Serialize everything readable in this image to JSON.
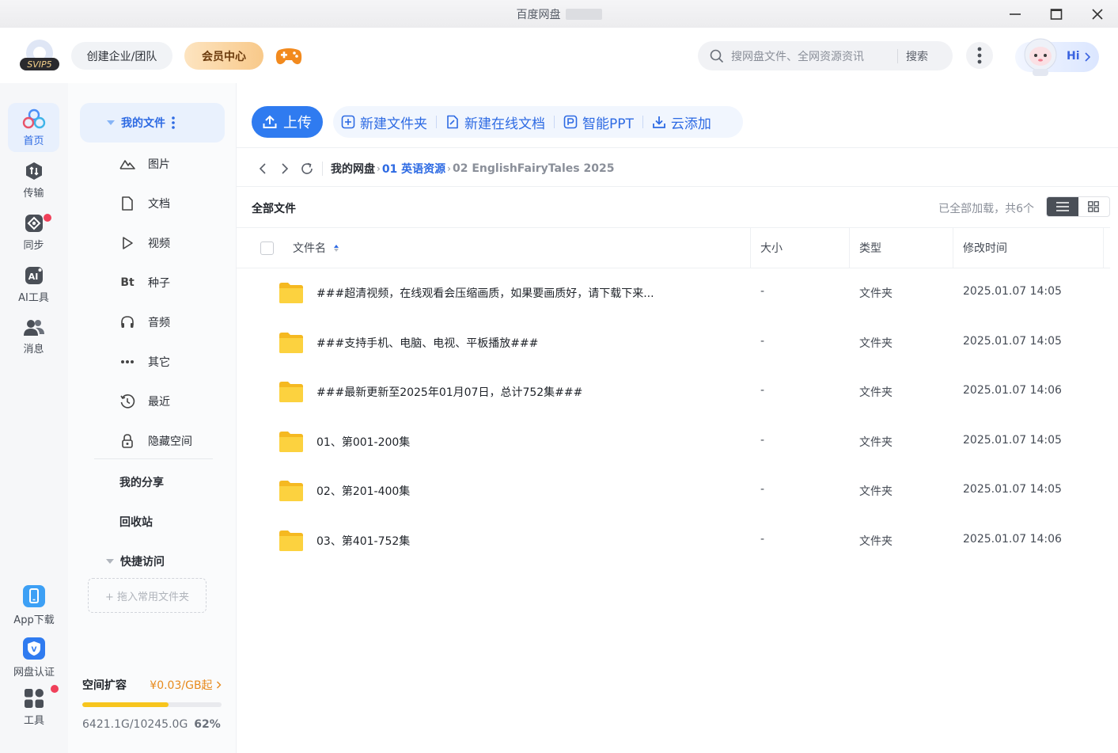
{
  "window": {
    "title": "百度网盘"
  },
  "header": {
    "logo_text": "SVIP5",
    "enterprise_label": "创建企业/团队",
    "vip_label": "会员中心",
    "search_placeholder": "搜网盘文件、全网资源资讯",
    "search_button": "搜索",
    "hi_label": "Hi"
  },
  "rail": {
    "items": [
      {
        "label": "首页",
        "icon": "home-icon"
      },
      {
        "label": "传输",
        "icon": "transfer-icon"
      },
      {
        "label": "同步",
        "icon": "sync-icon"
      },
      {
        "label": "AI工具",
        "icon": "ai-tool-icon"
      },
      {
        "label": "消息",
        "icon": "message-icon"
      }
    ],
    "bottom": [
      {
        "label": "App下载",
        "icon": "phone-icon"
      },
      {
        "label": "网盘认证",
        "icon": "verify-icon"
      },
      {
        "label": "工具",
        "icon": "tools-icon"
      }
    ]
  },
  "sidebar": {
    "my_files": "我的文件",
    "categories": [
      {
        "label": "图片",
        "icon": "picture-icon"
      },
      {
        "label": "文档",
        "icon": "document-icon"
      },
      {
        "label": "视频",
        "icon": "video-icon"
      },
      {
        "label": "种子",
        "icon": "torrent-icon",
        "glyph": "Bt"
      },
      {
        "label": "音频",
        "icon": "headphones-icon"
      },
      {
        "label": "其它",
        "icon": "more-dots-icon"
      },
      {
        "label": "最近",
        "icon": "history-icon"
      },
      {
        "label": "隐藏空间",
        "icon": "lock-icon"
      }
    ],
    "my_share": "我的分享",
    "recycle": "回收站",
    "quick_access": "快捷访问",
    "drop_hint": "+ 拖入常用文件夹",
    "storage": {
      "label": "空间扩容",
      "price": "¥0.03/GB起",
      "used": "6421.1G/10245.0G",
      "percent_text": "62%",
      "percent": 62
    }
  },
  "toolbar": {
    "upload": "上传",
    "new_folder": "新建文件夹",
    "new_doc": "新建在线文档",
    "smart_ppt": "智能PPT",
    "cloud_add": "云添加"
  },
  "breadcrumb": {
    "root": "我的网盘",
    "level1": "01 英语资源",
    "current": "02 EnglishFairyTales 2025"
  },
  "list": {
    "title": "全部文件",
    "status": "已全部加载，共6个",
    "columns": {
      "name": "文件名",
      "size": "大小",
      "type": "类型",
      "time": "修改时间"
    },
    "rows": [
      {
        "name": "###超清视频，在线观看会压缩画质，如果要画质好，请下载下来...",
        "size": "-",
        "type": "文件夹",
        "time": "2025.01.07 14:05"
      },
      {
        "name": "###支持手机、电脑、电视、平板播放###",
        "size": "-",
        "type": "文件夹",
        "time": "2025.01.07 14:05"
      },
      {
        "name": "###最新更新至2025年01月07日，总计752集###",
        "size": "-",
        "type": "文件夹",
        "time": "2025.01.07 14:06"
      },
      {
        "name": "01、第001-200集",
        "size": "-",
        "type": "文件夹",
        "time": "2025.01.07 14:05"
      },
      {
        "name": "02、第201-400集",
        "size": "-",
        "type": "文件夹",
        "time": "2025.01.07 14:05"
      },
      {
        "name": "03、第401-752集",
        "size": "-",
        "type": "文件夹",
        "time": "2025.01.07 14:06"
      }
    ]
  },
  "colors": {
    "accent": "#2f7bf0",
    "link": "#2d6ae3",
    "folder": "#f9c733",
    "storage_bar": "#f7c51e",
    "badge": "#f0405a"
  }
}
